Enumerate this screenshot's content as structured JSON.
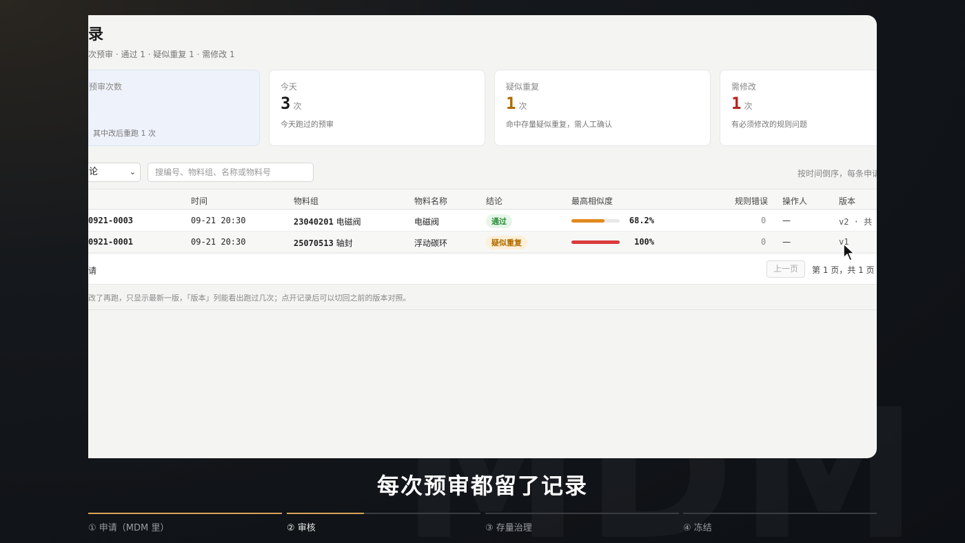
{
  "watermark": "MDM",
  "page": {
    "title": "录",
    "summary": "次预审 · 通过 1 · 疑似重复 1 · 需修改 1"
  },
  "stats": [
    {
      "label": "预审次数",
      "value": "",
      "unit": "",
      "desc": "其中改后重跑 1 次"
    },
    {
      "label": "今天",
      "value": "3",
      "unit": "次",
      "desc": "今天跑过的预审"
    },
    {
      "label": "疑似重复",
      "value": "1",
      "unit": "次",
      "desc": "命中存量疑似重复，需人工确认"
    },
    {
      "label": "需修改",
      "value": "1",
      "unit": "次",
      "desc": "有必须修改的规则问题"
    }
  ],
  "filters": {
    "select_value": "论",
    "search_placeholder": "搜编号、物料组、名称或物料号",
    "sort_hint": "按时间倒序，每条申请"
  },
  "table": {
    "headers": {
      "time": "时间",
      "group": "物料组",
      "name": "物料名称",
      "verdict": "结论",
      "similarity": "最高相似度",
      "rule_errors": "规则错误",
      "operator": "操作人",
      "version": "版本"
    },
    "rows": [
      {
        "id": "0921-0003",
        "time": "09-21 20:30",
        "group_code": "23040201",
        "group_name": "电磁阀",
        "name": "电磁阀",
        "verdict": "通过",
        "similarity_text": "68.2%",
        "similarity": 0.682,
        "rule_errors": "0",
        "operator": "—",
        "version": "v2 · 共"
      },
      {
        "id": "0921-0001",
        "time": "09-21 20:30",
        "group_code": "25070513",
        "group_name": "轴封",
        "name": "浮动碳环",
        "verdict": "疑似重复",
        "similarity_text": "100%",
        "similarity": 1.0,
        "rule_errors": "0",
        "operator": "—",
        "version": "v1"
      }
    ]
  },
  "footer": {
    "count": "请",
    "prev": "上一页",
    "page_info": "第 1 页，共 1 页"
  },
  "note": "改了再跑，只显示最新一版，「版本」列能看出跑过几次；点开记录后可以切回之前的版本对照。",
  "subtitle": "每次预审都留了记录",
  "steps": [
    {
      "label": "① 申请（MDM 里）",
      "progress": 1.0
    },
    {
      "label": "② 审核",
      "progress": 0.4
    },
    {
      "label": "③ 存量治理",
      "progress": 0
    },
    {
      "label": "④ 冻结",
      "progress": 0
    }
  ],
  "colors": {
    "accent": "#d9a45a",
    "pass": "#2e8b3a",
    "duplicate": "#b06a00",
    "needs_fix": "#b3261e",
    "bar_orange": "#e08a1e",
    "bar_red": "#d93b3b"
  }
}
